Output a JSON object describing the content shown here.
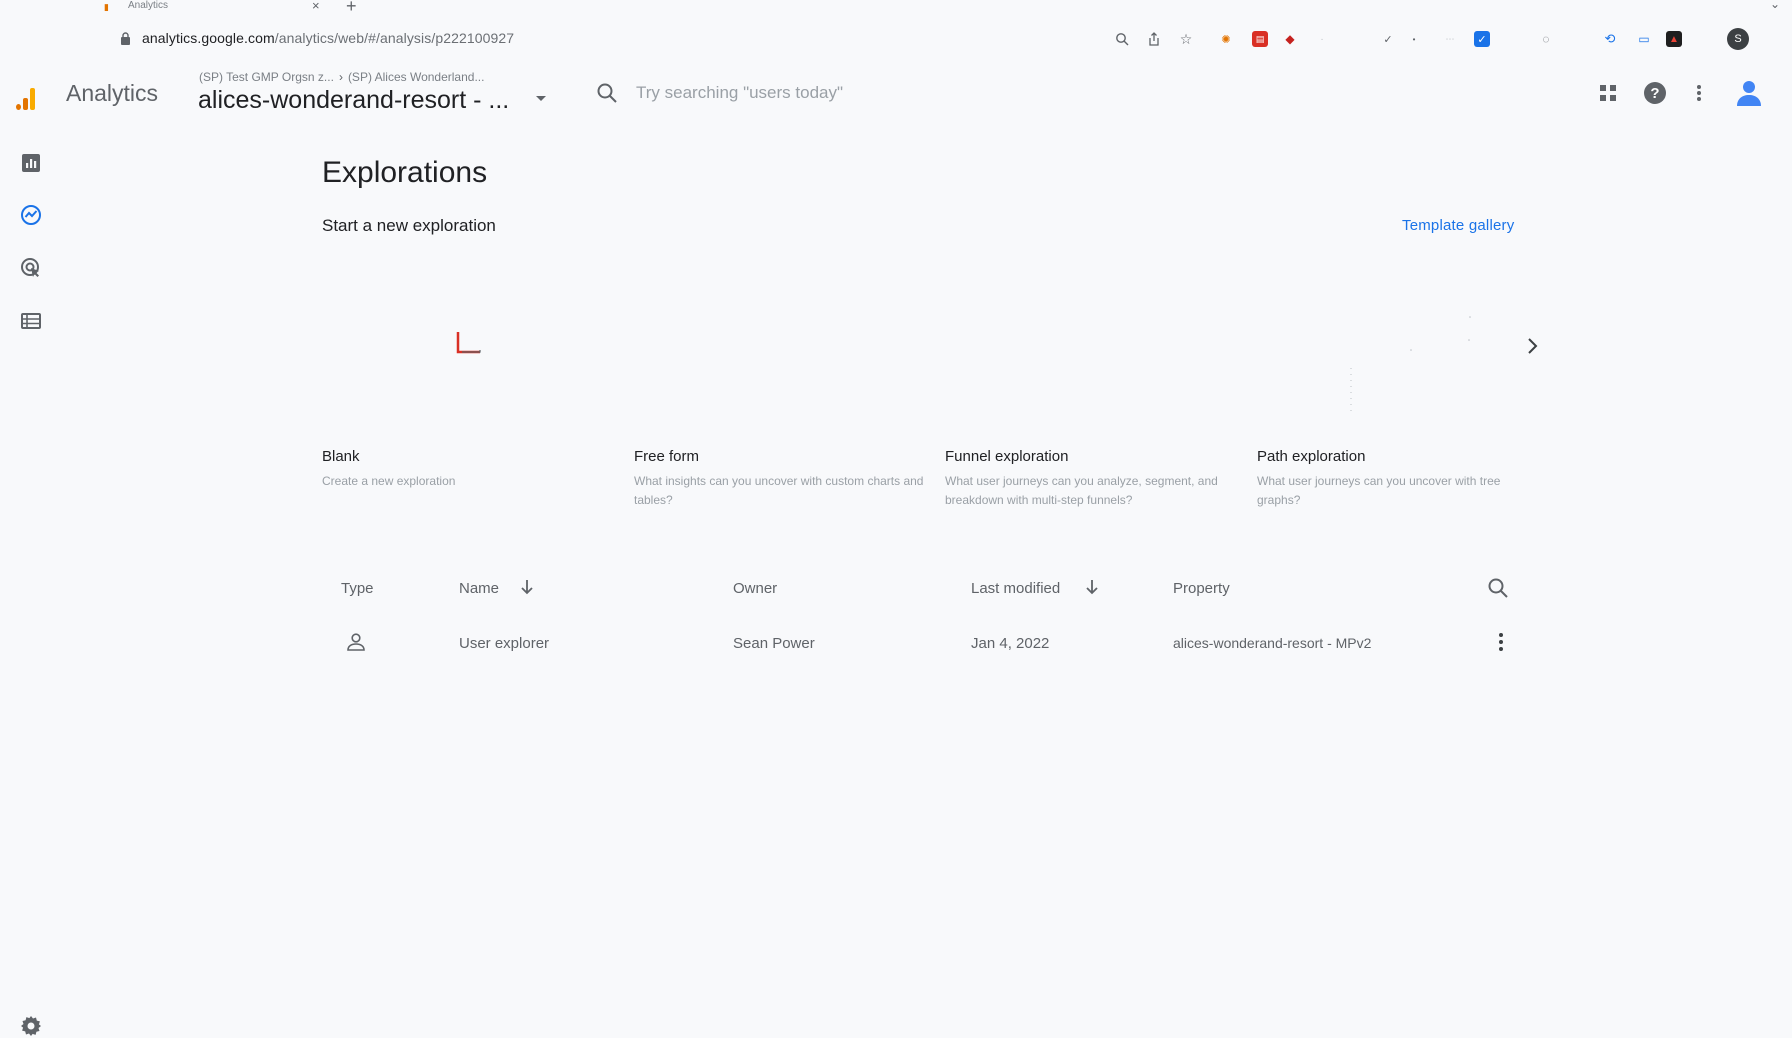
{
  "browser": {
    "tab_title": "Analytics",
    "url_host": "analytics.google.com",
    "url_path": "/analytics/web/#/analysis/p222100927",
    "profile_initial": "S",
    "extensions": [
      "zoom-icon",
      "share-icon",
      "star-icon",
      "ext-1",
      "ext-2",
      "ext-3",
      "ext-4",
      "ext-5",
      "ext-6",
      "ext-7",
      "ext-8",
      "ext-9",
      "ext-10"
    ]
  },
  "header": {
    "app_name": "Analytics",
    "breadcrumb_account": "(SP) Test GMP Orgsn z...",
    "breadcrumb_property": "(SP) Alices Wonderland...",
    "property_title": "alices-wonderand-resort - ...",
    "search_placeholder": "Try searching \"users today\""
  },
  "main": {
    "page_title": "Explorations",
    "section_title": "Start a new exploration",
    "template_gallery_label": "Template gallery",
    "cards": [
      {
        "title": "Blank",
        "description": "Create a new exploration"
      },
      {
        "title": "Free form",
        "description": "What insights can you uncover with custom charts and tables?"
      },
      {
        "title": "Funnel exploration",
        "description": "What user journeys can you analyze, segment, and breakdown with multi-step funnels?"
      },
      {
        "title": "Path exploration",
        "description": "What user journeys can you uncover with tree graphs?"
      }
    ]
  },
  "table": {
    "columns": {
      "type": "Type",
      "name": "Name",
      "owner": "Owner",
      "last_modified": "Last modified",
      "property": "Property"
    },
    "rows": [
      {
        "name": "User explorer",
        "owner": "Sean Power",
        "last_modified": "Jan 4, 2022",
        "property": "alices-wonderand-resort - MPv2"
      }
    ]
  },
  "colors": {
    "accent": "#1a73e8",
    "logo_orange": "#f9ab00",
    "logo_dark_orange": "#e37400",
    "blank_card_red": "#d93025"
  }
}
